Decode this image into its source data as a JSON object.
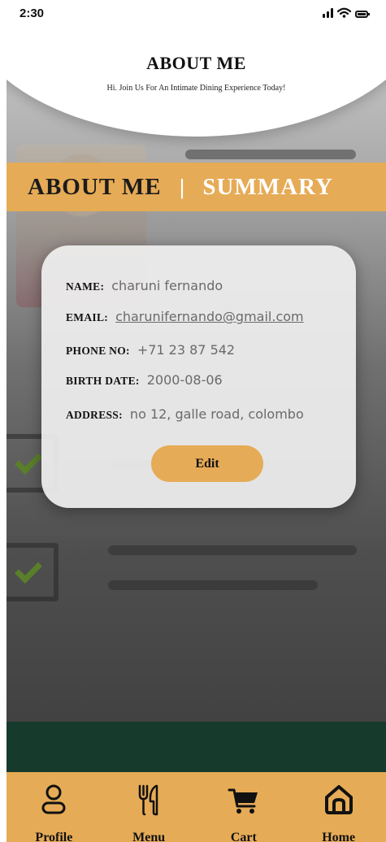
{
  "status_bar": {
    "time": "2:30"
  },
  "header": {
    "title": "ABOUT ME",
    "subtitle": "Hi. Join Us For An Intimate Dining Experience Today!"
  },
  "tabs": {
    "active": "ABOUT ME",
    "separator": "|",
    "inactive": "SUMMARY"
  },
  "profile": {
    "name": {
      "label": "NAME:",
      "value": "charuni fernando"
    },
    "email": {
      "label": "EMAIL:",
      "value": "charunifernando@gmail.com"
    },
    "phone": {
      "label": "PHONE NO:",
      "value": "+71 23 87 542"
    },
    "birth_date": {
      "label": "BIRTH DATE:",
      "value": "2000-08-06"
    },
    "address": {
      "label": "ADDRESS:",
      "value": "no 12, galle road, colombo"
    },
    "edit_label": "Edit"
  },
  "bottom_nav": {
    "items": [
      {
        "label": "Profile",
        "icon": "profile-icon"
      },
      {
        "label": "Menu",
        "icon": "fork-knife-icon"
      },
      {
        "label": "Cart",
        "icon": "cart-icon"
      },
      {
        "label": "Home",
        "icon": "home-icon"
      }
    ]
  },
  "colors": {
    "accent": "#e6ab56",
    "dark_band": "#163a2c",
    "card": "#efefef"
  }
}
